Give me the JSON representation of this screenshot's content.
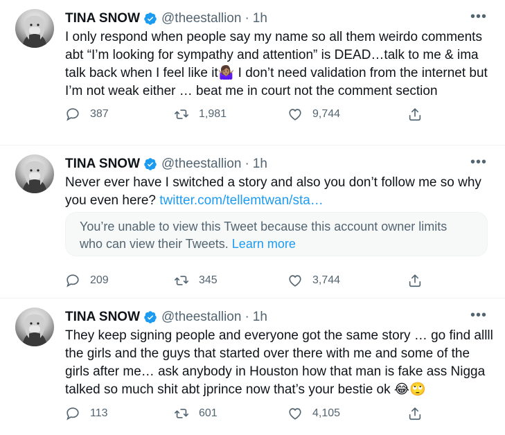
{
  "tweets": [
    {
      "name": "TINA SNOW",
      "handle": "@theestallion",
      "time": "1h",
      "text": "I only respond when people say my name so all them weirdo comments abt “I’m looking for sympathy and attention” is DEAD…talk to me & ima talk back when I feel like it🤷🏽‍♀️ I don’t need validation from the internet but I’m not weak either … beat me in court not the comment section",
      "replies": "387",
      "retweets": "1,981",
      "likes": "9,744"
    },
    {
      "name": "TINA SNOW",
      "handle": "@theestallion",
      "time": "1h",
      "text": "Never ever have I switched a story and also you don’t follow me so why you even here?",
      "link": "twitter.com/tellemtwan/sta…",
      "quote_text": "You’re unable to view this Tweet because this account owner limits who can view their Tweets.",
      "quote_link": "Learn more",
      "replies": "209",
      "retweets": "345",
      "likes": "3,744"
    },
    {
      "name": "TINA SNOW",
      "handle": "@theestallion",
      "time": "1h",
      "text": "They keep signing people and everyone got the same story … go find allll the girls and the guys that started over there with me and some of the girls after me… ask anybody in Houston how that man is fake ass Nigga talked so much shit abt jprince now that’s your bestie ok 😂🙄",
      "replies": "113",
      "retweets": "601",
      "likes": "4,105"
    }
  ],
  "colors": {
    "accent": "#1d9bf0",
    "secondary_text": "#536471",
    "primary_text": "#0f1419"
  },
  "icons": [
    "verified-badge-icon",
    "more-icon",
    "reply-icon",
    "retweet-icon",
    "like-icon",
    "share-icon"
  ]
}
